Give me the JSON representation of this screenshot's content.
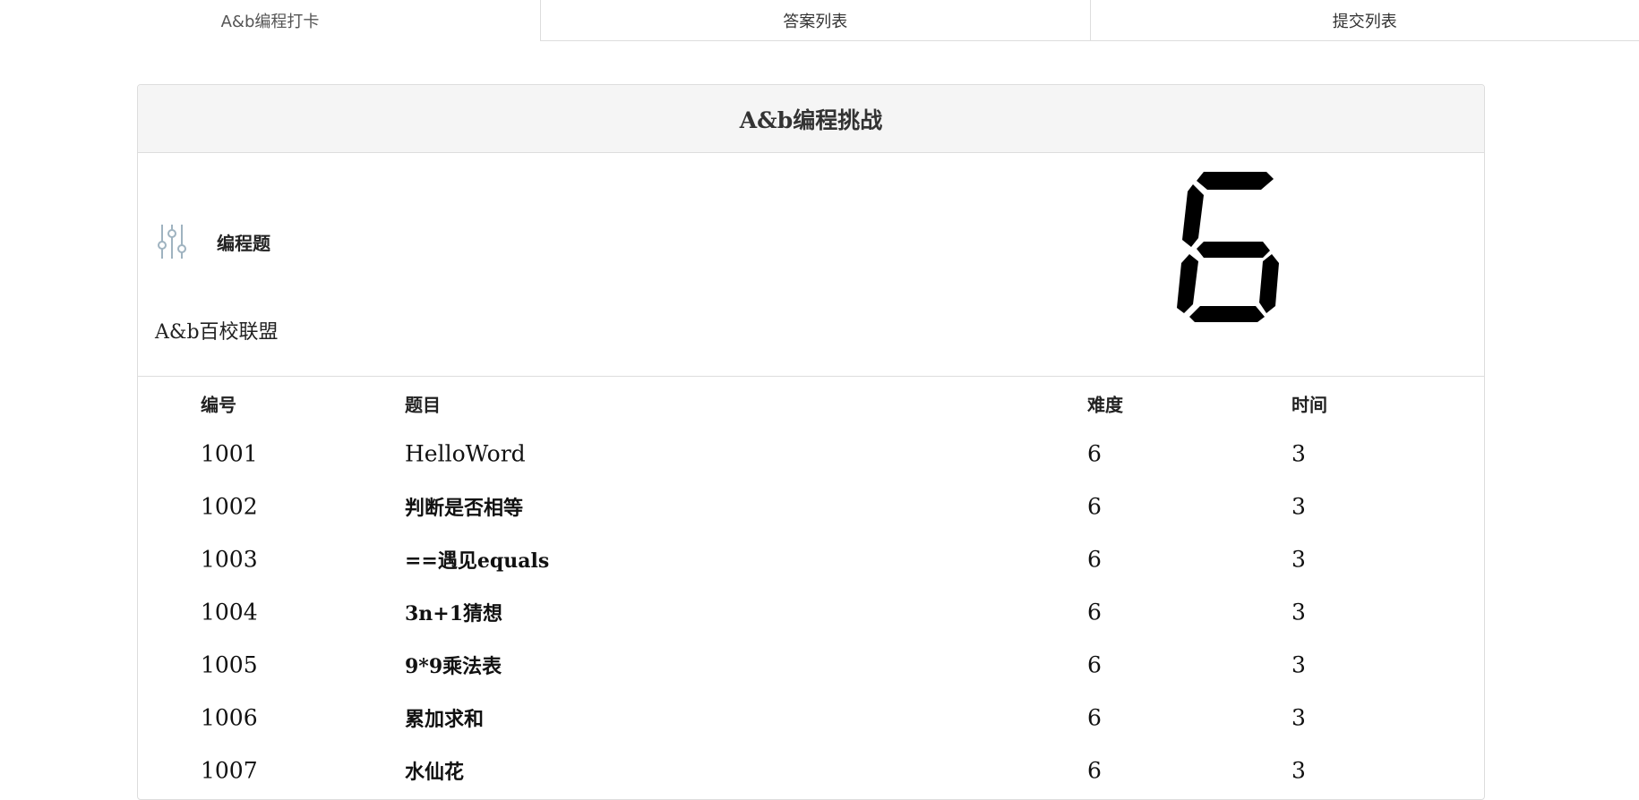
{
  "tabs": [
    {
      "label": "A&b编程打卡",
      "active": true
    },
    {
      "label": "答案列表",
      "active": false
    },
    {
      "label": "提交列表",
      "active": false
    }
  ],
  "panel": {
    "title": "A&b编程挑战",
    "type_label": "编程题",
    "org_label": "A&b百校联盟",
    "big_digit": "6"
  },
  "table": {
    "headers": {
      "id": "编号",
      "title": "题目",
      "difficulty": "难度",
      "time": "时间"
    },
    "rows": [
      {
        "id": "1001",
        "title": "HelloWord",
        "difficulty": "6",
        "time": "3"
      },
      {
        "id": "1002",
        "title": "判断是否相等",
        "difficulty": "6",
        "time": "3"
      },
      {
        "id": "1003",
        "title": "==遇见equals",
        "difficulty": "6",
        "time": "3"
      },
      {
        "id": "1004",
        "title": "3n+1猜想",
        "difficulty": "6",
        "time": "3"
      },
      {
        "id": "1005",
        "title": "9*9乘法表",
        "difficulty": "6",
        "time": "3"
      },
      {
        "id": "1006",
        "title": "累加求和",
        "difficulty": "6",
        "time": "3"
      },
      {
        "id": "1007",
        "title": "水仙花",
        "difficulty": "6",
        "time": "3"
      }
    ]
  },
  "icons": {
    "type_icon": "sliders-icon"
  },
  "colors": {
    "border": "#dddddd",
    "heading_bg": "#f5f5f5",
    "digit": "#000000",
    "icon": "#9fb3c0"
  }
}
